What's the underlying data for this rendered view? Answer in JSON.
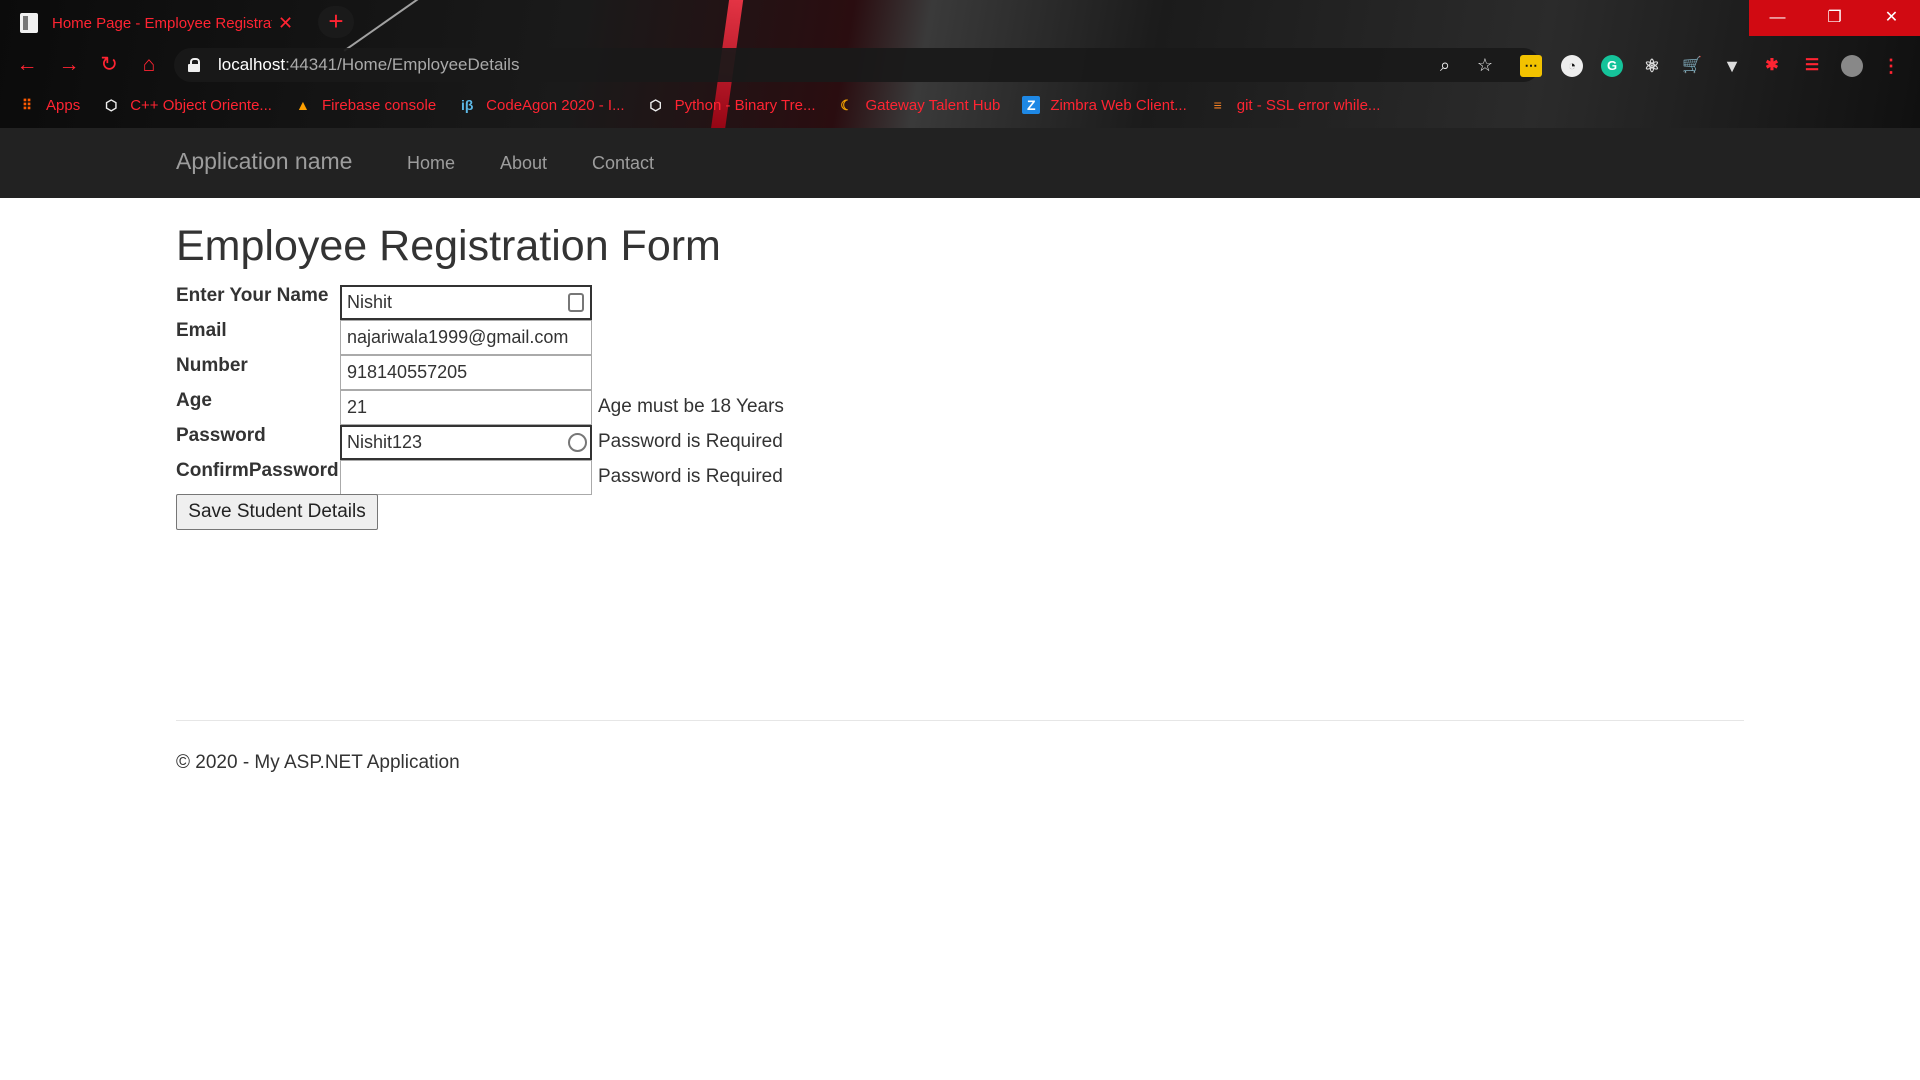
{
  "browser": {
    "tab_title": "Home Page - Employee Registrat",
    "tab_close": "✕",
    "new_tab": "+",
    "url_host": "localhost",
    "url_path": ":44341/Home/EmployeeDetails",
    "window_controls": {
      "minimize": "—",
      "restore": "❐",
      "close": "✕"
    },
    "bookmarks": [
      {
        "label": "Apps",
        "icon": "apps-grid-icon"
      },
      {
        "label": "C++ Object Oriente...",
        "icon": "hexagon-icon"
      },
      {
        "label": "Firebase console",
        "icon": "firebase-icon"
      },
      {
        "label": "CodeAgon 2020 - I...",
        "icon": "ib-icon"
      },
      {
        "label": "Python - Binary Tre...",
        "icon": "hexagon-icon"
      },
      {
        "label": "Gateway Talent Hub",
        "icon": "gateway-icon"
      },
      {
        "label": "Zimbra Web Client...",
        "icon": "zimbra-icon"
      },
      {
        "label": "git - SSL error while...",
        "icon": "stackoverflow-icon"
      }
    ],
    "accent_color": "#ff2432"
  },
  "navbar": {
    "brand": "Application name",
    "links": [
      "Home",
      "About",
      "Contact"
    ]
  },
  "form": {
    "title": "Employee Registration Form",
    "fields": [
      {
        "label": "Enter Your Name",
        "value": "Nishit",
        "message": ""
      },
      {
        "label": "Email",
        "value": "najariwala1999@gmail.com",
        "message": ""
      },
      {
        "label": "Number",
        "value": "918140557205",
        "message": ""
      },
      {
        "label": "Age",
        "value": "21",
        "message": "Age must be 18 Years"
      },
      {
        "label": "Password",
        "value": "Nishit123",
        "message": "Password is Required"
      },
      {
        "label": "ConfirmPassword",
        "value": "",
        "message": "Password is Required"
      }
    ],
    "submit_label": "Save Student Details"
  },
  "footer": {
    "text": "© 2020 - My ASP.NET Application"
  }
}
